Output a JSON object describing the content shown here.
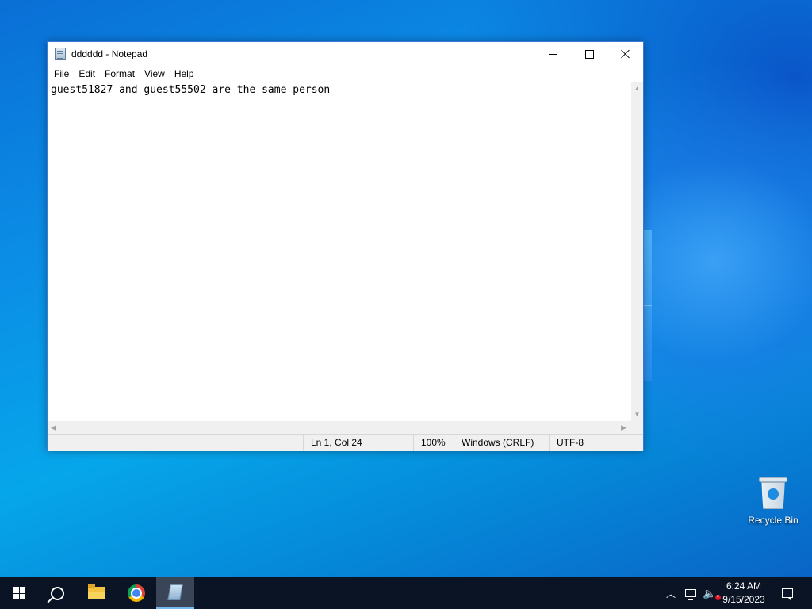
{
  "window": {
    "title": "dddddd - Notepad",
    "menu": [
      "File",
      "Edit",
      "Format",
      "View",
      "Help"
    ]
  },
  "editor": {
    "content": "guest51827 and guest55502 are the same person"
  },
  "statusbar": {
    "position": "Ln 1, Col 24",
    "zoom": "100%",
    "line_ending": "Windows (CRLF)",
    "encoding": "UTF-8"
  },
  "desktop": {
    "icons": [
      {
        "label": "Recycle Bin",
        "icon": "recycle-bin-icon"
      }
    ]
  },
  "taskbar": {
    "apps": [
      {
        "name": "start",
        "icon": "windows-logo-icon"
      },
      {
        "name": "search",
        "icon": "search-icon"
      },
      {
        "name": "file-explorer",
        "icon": "folder-icon"
      },
      {
        "name": "chrome",
        "icon": "chrome-icon"
      },
      {
        "name": "notepad",
        "icon": "notepad-icon",
        "active": true
      }
    ],
    "clock": {
      "time": "6:24 AM",
      "date": "9/15/2023"
    }
  },
  "colors": {
    "taskbar": "#0a1424",
    "accent": "#76b9ed"
  }
}
